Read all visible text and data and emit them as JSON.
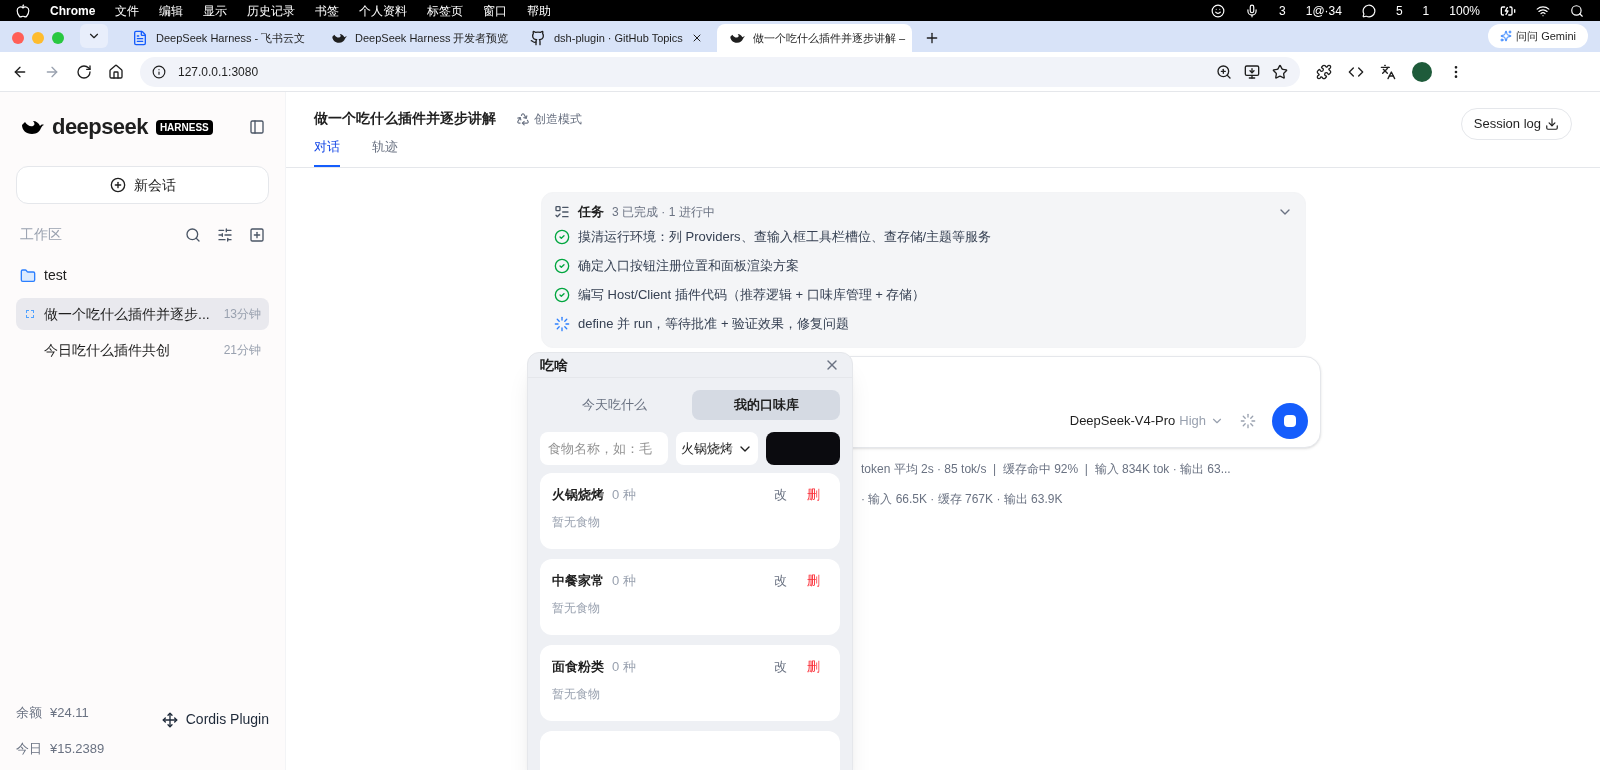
{
  "menubar": {
    "app": "Chrome",
    "menus": [
      "文件",
      "编辑",
      "显示",
      "历史记录",
      "书签",
      "个人资料",
      "标签页",
      "窗口",
      "帮助"
    ],
    "status": [
      "3",
      "1@·34",
      "5",
      "1",
      "100%"
    ]
  },
  "browser_tabs": [
    {
      "kind": "doc",
      "title": "DeepSeek Harness - 飞书云文",
      "selected": false
    },
    {
      "kind": "whale",
      "title": "DeepSeek Harness 开发者预览",
      "selected": false
    },
    {
      "kind": "github",
      "title": "dsh-plugin · GitHub Topics",
      "selected": false
    },
    {
      "kind": "whale",
      "title": "做一个吃什么插件并逐步讲解 –",
      "selected": true
    }
  ],
  "gemini_button": "问问 Gemini",
  "address": "127.0.0.1:3080",
  "sidebar": {
    "brand": "deepseek",
    "badge": "HARNESS",
    "new_chat": "新会话",
    "workspace_label": "工作区",
    "folder": "test",
    "sessions": [
      {
        "title": "做一个吃什么插件并逐步...",
        "time": "13分钟",
        "selected": true,
        "running": true
      },
      {
        "title": "今日吃什么插件共创",
        "time": "21分钟",
        "selected": false,
        "running": false
      }
    ],
    "balance_label": "余额",
    "balance": "¥24.11",
    "today_label": "今日",
    "today": "¥15.2389",
    "plugin": "Cordis Plugin"
  },
  "header": {
    "title": "做一个吃什么插件并逐步讲解",
    "mode": "创造模式",
    "session_log": "Session log",
    "tabs": [
      {
        "label": "对话",
        "selected": true
      },
      {
        "label": "轨迹",
        "selected": false
      }
    ]
  },
  "tasks": {
    "title": "任务",
    "summary": "3 已完成 · 1 进行中",
    "expanded": true,
    "items": [
      {
        "text": "摸清运行环境：列 Providers、查输入框工具栏槽位、查存储/主题等服务",
        "done": true
      },
      {
        "text": "确定入口按钮注册位置和面板渲染方案",
        "done": true
      },
      {
        "text": "编写 Host/Client 插件代码（推荐逻辑 + 口味库管理 + 存储）",
        "done": true
      },
      {
        "text": "define 并 run，等待批准 + 验证效果，修复问题",
        "done": false
      }
    ]
  },
  "composer": {
    "model": "DeepSeek-V4-Pro",
    "effort": "High"
  },
  "stats": [
    "token 平均 2s · 85 tok/s  |  缓存命中 92%  |  输入 834K tok · 输出 63...",
    "· 输入 66.5K · 缓存 767K · 输出 63.9K"
  ],
  "popup": {
    "title": "吃啥",
    "tabs": [
      {
        "label": "今天吃什么",
        "selected": false
      },
      {
        "label": "我的口味库",
        "selected": true
      }
    ],
    "food_placeholder": "食物名称，如：毛",
    "category": "火锅烧烤",
    "categories": [
      {
        "name": "火锅烧烤",
        "count": "0 种",
        "edit": "改",
        "delete": "删",
        "empty": "暂无食物"
      },
      {
        "name": "中餐家常",
        "count": "0 种",
        "edit": "改",
        "delete": "删",
        "empty": "暂无食物"
      },
      {
        "name": "面食粉类",
        "count": "0 种",
        "edit": "改",
        "delete": "删",
        "empty": "暂无食物"
      }
    ]
  }
}
